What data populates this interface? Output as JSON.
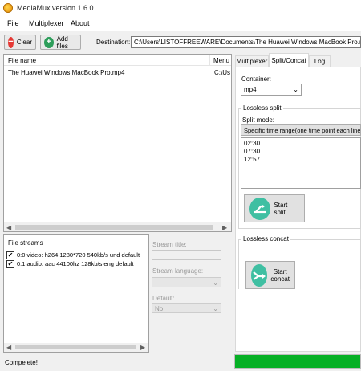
{
  "window": {
    "title": "MediaMux version 1.6.0"
  },
  "menu": {
    "items": [
      "File",
      "Multiplexer",
      "About"
    ]
  },
  "toolbar": {
    "clear_label": "Clear",
    "add_files_label": "Add files",
    "destination_label": "Destination:",
    "destination_value": "C:\\Users\\LISTOFFREEWARE\\Documents\\The Huawei Windows MacBook Pro.mkv"
  },
  "file_list": {
    "columns": [
      "File name",
      "Menu"
    ],
    "rows": [
      {
        "file_name": "The Huawei Windows MacBook Pro.mp4",
        "menu": "C:\\Us"
      }
    ]
  },
  "file_streams": {
    "label": "File streams",
    "items": [
      {
        "checked": true,
        "text": "0:0 video: h264 1280*720 540kb/s und default"
      },
      {
        "checked": true,
        "text": "0:1 audio: aac 44100hz 128kb/s eng default"
      }
    ]
  },
  "stream_props": {
    "title_label": "Stream title:",
    "language_label": "Stream language:",
    "default_label": "Default:",
    "default_value": "No"
  },
  "tabs": {
    "items": [
      "Multiplexer",
      "Split/Concat",
      "Log"
    ],
    "active": "Split/Concat"
  },
  "split_concat": {
    "container_label": "Container:",
    "container_value": "mp4",
    "lossless_split_label": "Lossless split",
    "split_mode_label": "Split mode:",
    "split_mode_value": "Specific time range(one time point each line)",
    "time_points": [
      "02:30",
      "07:30",
      "12:57"
    ],
    "start_split_label": "Start split",
    "lossless_concat_label": "Lossless concat",
    "start_concat_label_1": "Start",
    "start_concat_label_2": "concat"
  },
  "status": {
    "text": "Compelete!",
    "progress": 1.0,
    "progress_color": "#06b025"
  }
}
